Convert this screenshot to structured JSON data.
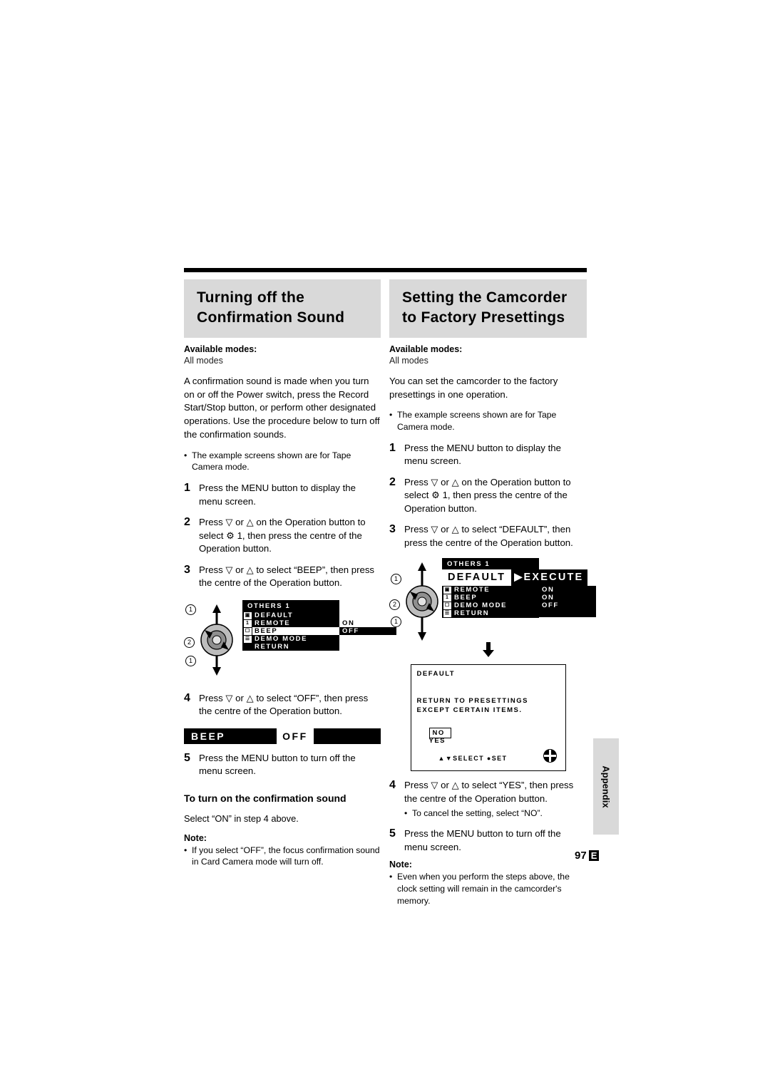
{
  "left": {
    "heading": "Turning off the Confirmation Sound",
    "available_label": "Available modes:",
    "available_value": "All modes",
    "intro": "A confirmation sound is made when you turn on or off the Power switch, press the Record Start/Stop button, or perform other designated operations. Use the procedure below to turn off the confirmation sounds.",
    "bullet": "The example screens shown are for Tape Camera mode.",
    "steps": [
      {
        "num": "1",
        "text": "Press the MENU button to display the menu screen."
      },
      {
        "num": "2",
        "text": "Press ▽ or △ on the Operation button to select ⚙ 1, then press the centre of the Operation button."
      },
      {
        "num": "3",
        "text": "Press ▽ or △ to select “BEEP”, then press the centre of the Operation button."
      },
      {
        "num": "4",
        "text": "Press ▽ or △ to select “OFF”, then press the centre of the Operation button."
      },
      {
        "num": "5",
        "text": "Press the MENU button to turn off the menu screen."
      }
    ],
    "lcd": {
      "title": "OTHERS 1",
      "rows": [
        "DEFAULT",
        "REMOTE",
        "BEEP",
        "DEMO MODE",
        "RETURN"
      ],
      "selected_row": 2,
      "values": [
        "",
        "",
        "ON",
        "OFF",
        ""
      ],
      "highlight_value": 2,
      "icons": [
        "■",
        "■",
        "■",
        "■"
      ]
    },
    "callouts": [
      "1",
      "2",
      "1"
    ],
    "banner": {
      "left": "BEEP",
      "right": "OFF"
    },
    "subhead": "To turn on the confirmation sound",
    "subnote": "Select “ON” in step 4 above.",
    "note_label": "Note:",
    "note_body": "If you select “OFF”, the focus confirmation sound in Card Camera mode will turn off."
  },
  "right": {
    "heading": "Setting the Camcorder to Factory Presettings",
    "available_label": "Available modes:",
    "available_value": "All modes",
    "intro": "You can set the camcorder to the factory presettings in one operation.",
    "bullet": "The example screens shown are for Tape Camera mode.",
    "steps": [
      {
        "num": "1",
        "text": "Press the MENU button to display the menu screen."
      },
      {
        "num": "2",
        "text": "Press ▽ or △ on the Operation button to select ⚙ 1, then press the centre of the Operation button."
      },
      {
        "num": "3",
        "text": "Press ▽ or △ to select  “DEFAULT”, then press the centre of the Operation button."
      },
      {
        "num": "4",
        "text": "Press ▽ or △ to select “YES”, then press the centre of the Operation button."
      },
      {
        "num": "5",
        "text": "Press the MENU button to turn off the menu screen."
      }
    ],
    "step4_bullet": "To cancel the setting, select “NO”.",
    "lcd": {
      "title": "OTHERS 1",
      "rows": [
        "DEFAULT",
        "REMOTE",
        "BEEP",
        "DEMO MODE",
        "RETURN"
      ],
      "selected_row": 0,
      "values": [
        "",
        "ON",
        "ON",
        "OFF",
        ""
      ],
      "icons": [
        "■",
        "■",
        "■",
        "■"
      ]
    },
    "exec_banner": {
      "left": "DEFAULT",
      "right": "EXECUTE"
    },
    "callouts": [
      "1",
      "2",
      "1"
    ],
    "dialog": {
      "title": "DEFAULT",
      "line1": "RETURN TO PRESETTINGS",
      "line2": "EXCEPT CERTAIN ITEMS.",
      "no": "NO",
      "yes": "YES",
      "select_set": "▲▼SELECT  ●SET"
    },
    "note_label": "Note:",
    "note_body": "Even when you perform the steps above, the clock setting will remain in the camcorder's memory."
  },
  "footer": {
    "appendix": "Appendix",
    "page": "97",
    "lang": "E"
  }
}
